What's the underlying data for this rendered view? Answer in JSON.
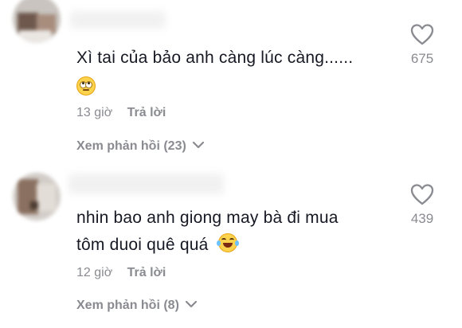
{
  "comments": [
    {
      "text_line1": "Xì tai của bảo anh càng lúc càng......",
      "emoji": "face-with-rolling-eyes-emoji",
      "time": "13 giờ",
      "reply_label": "Trả lời",
      "view_replies": "Xem phản hồi (23)",
      "like_count": "675"
    },
    {
      "text_line1": "nhin bao anh giong may bà đi mua",
      "text_line2": "tôm duoi quê quá",
      "emoji": "face-with-tears-of-joy-emoji",
      "time": "12 giờ",
      "reply_label": "Trả lời",
      "view_replies": "Xem phản hồi (8)",
      "like_count": "439"
    }
  ],
  "icons": {
    "like": "heart-outline-icon",
    "expand": "chevron-down-icon"
  },
  "colors": {
    "text_primary": "#161823",
    "text_secondary": "#8a8b91",
    "background": "#ffffff"
  }
}
